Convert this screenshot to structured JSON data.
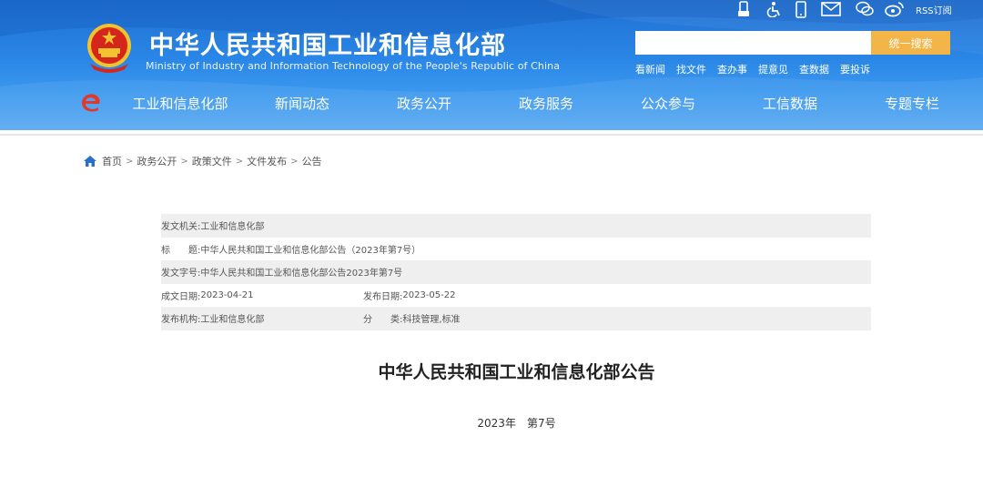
{
  "header": {
    "title_cn": "中华人民共和国工业和信息化部",
    "title_en": "Ministry of Industry and Information Technology of the People's Republic of China",
    "rss_label": "RSS订阅",
    "icons": [
      "mobile-icon",
      "accessibility-icon",
      "phone-icon",
      "mail-icon",
      "wechat-icon",
      "weibo-icon",
      "rss-icon"
    ]
  },
  "search": {
    "value": "",
    "button_label": "统一搜索"
  },
  "quick_links": [
    "看新闻",
    "找文件",
    "查办事",
    "提意见",
    "查数据",
    "要投诉"
  ],
  "nav": [
    "工业和信息化部",
    "新闻动态",
    "政务公开",
    "政务服务",
    "公众参与",
    "工信数据",
    "专题专栏"
  ],
  "breadcrumb": {
    "items": [
      "首页",
      "政务公开",
      "政策文件",
      "文件发布",
      "公告"
    ],
    "separator": ">"
  },
  "meta": {
    "issuer_label": "发文机关:",
    "issuer": "工业和信息化部",
    "title_label": "标　　题:",
    "title": "中华人民共和国工业和信息化部公告（2023年第7号）",
    "doc_no_label": "发文字号:",
    "doc_no": "中华人民共和国工业和信息化部公告2023年第7号",
    "created_label": "成文日期:",
    "created": "2023-04-21",
    "published_label": "发布日期:",
    "published": "2023-05-22",
    "org_label": "发布机构:",
    "org": "工业和信息化部",
    "category_label": "分　　类:",
    "category": "科技管理,标准"
  },
  "document": {
    "title": "中华人民共和国工业和信息化部公告",
    "number": "2023年　第7号"
  },
  "colors": {
    "header_blue": "#2a86e6",
    "search_button": "#f4b548",
    "nav_logo_red": "#e2372b",
    "alt_row": "#efefef"
  }
}
